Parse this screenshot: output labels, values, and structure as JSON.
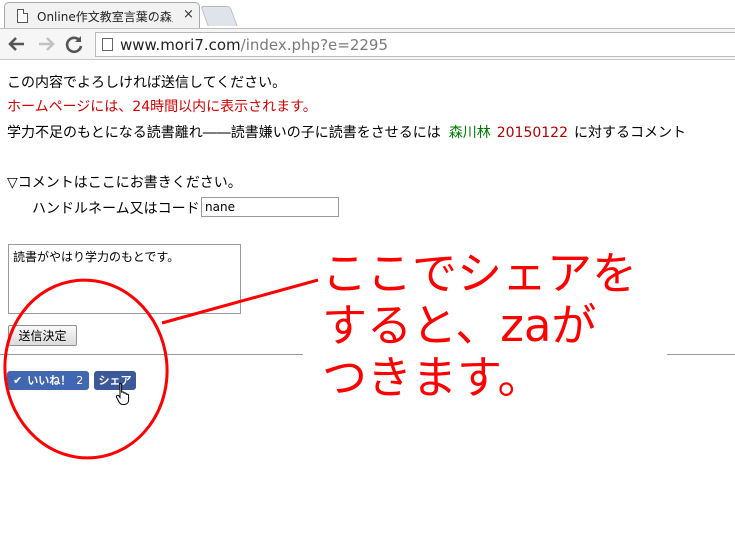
{
  "browser": {
    "tab_title": "Online作文教室言葉の森／",
    "tab_close": "×",
    "url_host": "www.mori7.com",
    "url_path": "/index.php?e=2295"
  },
  "page": {
    "confirm_text": "この内容でよろしければ送信してください。",
    "notice_text": "ホームページには、24時間以内に表示されます。",
    "article_title": "学力不足のもとになる読書離れ――読書嫌いの子に読書をさせるには",
    "article_author": "森川林",
    "article_date": "20150122",
    "article_suffix": "に対するコメント",
    "comment_prompt": "▽コメントはここにお書きください。",
    "handle_label": "ハンドルネーム又はコード:",
    "handle_value": "nane",
    "comment_value": "読書がやはり学力のもとです。",
    "submit_label": "送信決定"
  },
  "social": {
    "like_label": "いいね！",
    "like_count": "2",
    "share_label": "シェア"
  },
  "annotation": {
    "line1": "ここでシェアを",
    "line2": "すると、zaが",
    "line3": "つきます。",
    "color": "#ff0000"
  }
}
